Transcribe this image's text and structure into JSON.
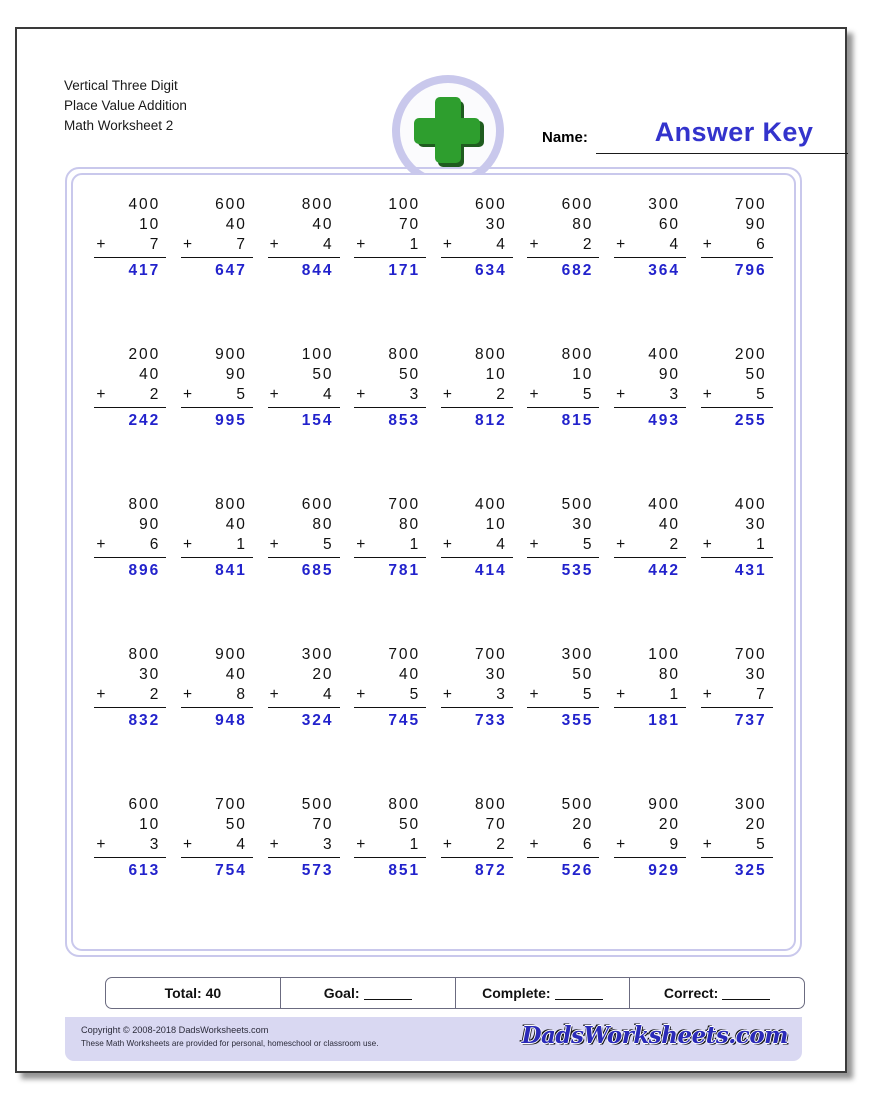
{
  "header": {
    "title_lines": [
      "Vertical Three Digit",
      "Place Value Addition",
      "Math Worksheet 2"
    ],
    "name_label": "Name:",
    "answer_key": "Answer Key",
    "logo_icon": "green-plus-icon"
  },
  "colors": {
    "answer_blue": "#2222cc",
    "answer_key_blue": "#3333cc",
    "frame_lavender": "#c9c8ec",
    "footer_lavender": "#d9d8f2",
    "logo_green": "#2e9e2e",
    "logo_green_dark": "#1f5c1f"
  },
  "operator": "+",
  "rows": [
    [
      {
        "a": "400",
        "b": "10",
        "c": "7",
        "sum": "417"
      },
      {
        "a": "600",
        "b": "40",
        "c": "7",
        "sum": "647"
      },
      {
        "a": "800",
        "b": "40",
        "c": "4",
        "sum": "844"
      },
      {
        "a": "100",
        "b": "70",
        "c": "1",
        "sum": "171"
      },
      {
        "a": "600",
        "b": "30",
        "c": "4",
        "sum": "634"
      },
      {
        "a": "600",
        "b": "80",
        "c": "2",
        "sum": "682"
      },
      {
        "a": "300",
        "b": "60",
        "c": "4",
        "sum": "364"
      },
      {
        "a": "700",
        "b": "90",
        "c": "6",
        "sum": "796"
      }
    ],
    [
      {
        "a": "200",
        "b": "40",
        "c": "2",
        "sum": "242"
      },
      {
        "a": "900",
        "b": "90",
        "c": "5",
        "sum": "995"
      },
      {
        "a": "100",
        "b": "50",
        "c": "4",
        "sum": "154"
      },
      {
        "a": "800",
        "b": "50",
        "c": "3",
        "sum": "853"
      },
      {
        "a": "800",
        "b": "10",
        "c": "2",
        "sum": "812"
      },
      {
        "a": "800",
        "b": "10",
        "c": "5",
        "sum": "815"
      },
      {
        "a": "400",
        "b": "90",
        "c": "3",
        "sum": "493"
      },
      {
        "a": "200",
        "b": "50",
        "c": "5",
        "sum": "255"
      }
    ],
    [
      {
        "a": "800",
        "b": "90",
        "c": "6",
        "sum": "896"
      },
      {
        "a": "800",
        "b": "40",
        "c": "1",
        "sum": "841"
      },
      {
        "a": "600",
        "b": "80",
        "c": "5",
        "sum": "685"
      },
      {
        "a": "700",
        "b": "80",
        "c": "1",
        "sum": "781"
      },
      {
        "a": "400",
        "b": "10",
        "c": "4",
        "sum": "414"
      },
      {
        "a": "500",
        "b": "30",
        "c": "5",
        "sum": "535"
      },
      {
        "a": "400",
        "b": "40",
        "c": "2",
        "sum": "442"
      },
      {
        "a": "400",
        "b": "30",
        "c": "1",
        "sum": "431"
      }
    ],
    [
      {
        "a": "800",
        "b": "30",
        "c": "2",
        "sum": "832"
      },
      {
        "a": "900",
        "b": "40",
        "c": "8",
        "sum": "948"
      },
      {
        "a": "300",
        "b": "20",
        "c": "4",
        "sum": "324"
      },
      {
        "a": "700",
        "b": "40",
        "c": "5",
        "sum": "745"
      },
      {
        "a": "700",
        "b": "30",
        "c": "3",
        "sum": "733"
      },
      {
        "a": "300",
        "b": "50",
        "c": "5",
        "sum": "355"
      },
      {
        "a": "100",
        "b": "80",
        "c": "1",
        "sum": "181"
      },
      {
        "a": "700",
        "b": "30",
        "c": "7",
        "sum": "737"
      }
    ],
    [
      {
        "a": "600",
        "b": "10",
        "c": "3",
        "sum": "613"
      },
      {
        "a": "700",
        "b": "50",
        "c": "4",
        "sum": "754"
      },
      {
        "a": "500",
        "b": "70",
        "c": "3",
        "sum": "573"
      },
      {
        "a": "800",
        "b": "50",
        "c": "1",
        "sum": "851"
      },
      {
        "a": "800",
        "b": "70",
        "c": "2",
        "sum": "872"
      },
      {
        "a": "500",
        "b": "20",
        "c": "6",
        "sum": "526"
      },
      {
        "a": "900",
        "b": "20",
        "c": "9",
        "sum": "929"
      },
      {
        "a": "300",
        "b": "20",
        "c": "5",
        "sum": "325"
      }
    ]
  ],
  "score_bar": [
    {
      "label": "Total: 40",
      "has_blank": false
    },
    {
      "label": "Goal:",
      "has_blank": true
    },
    {
      "label": "Complete:",
      "has_blank": true
    },
    {
      "label": "Correct:",
      "has_blank": true
    }
  ],
  "footer": {
    "copyright": "Copyright © 2008-2018 DadsWorksheets.com",
    "usage": "These Math Worksheets are provided for personal, homeschool or classroom use.",
    "site_logo": "DadsWorksheets.com"
  }
}
